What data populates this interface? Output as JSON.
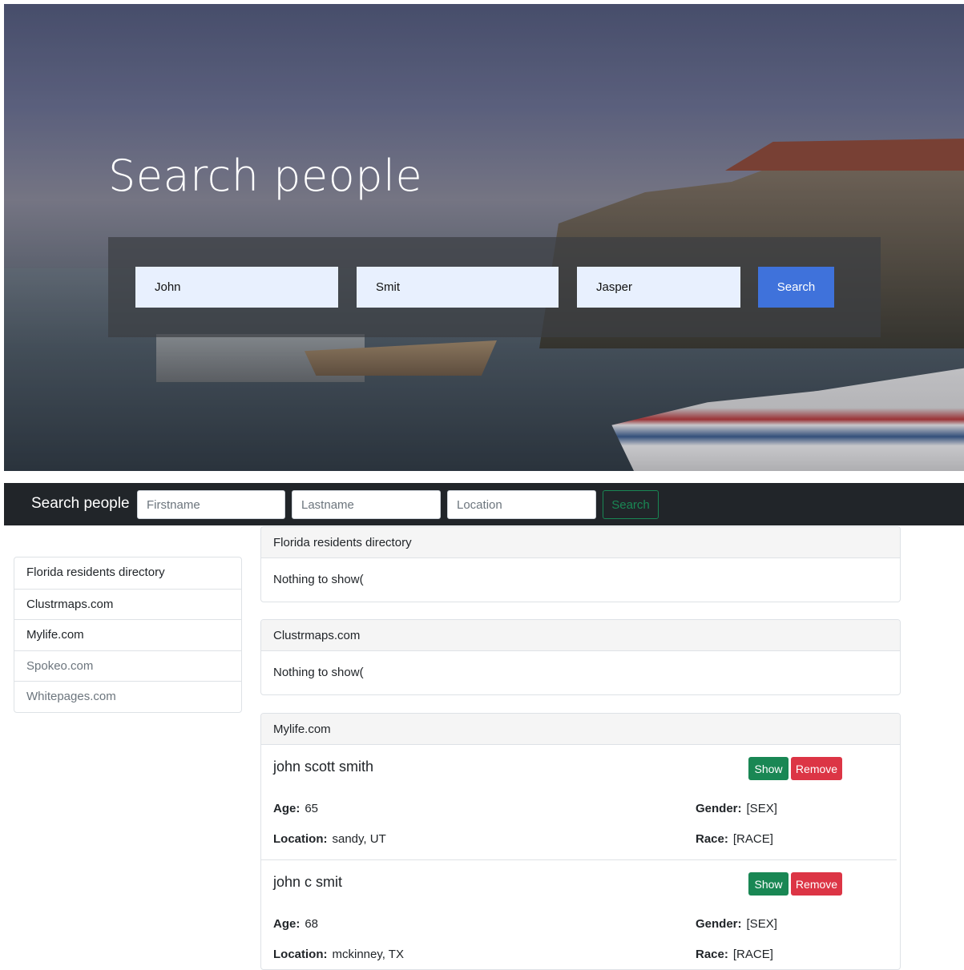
{
  "hero": {
    "title": "Search people",
    "firstname_value": "John",
    "lastname_value": "Smit",
    "location_value": "Jasper",
    "search_label": "Search"
  },
  "navbar": {
    "brand": "Search people",
    "firstname_placeholder": "Firstname",
    "lastname_placeholder": "Lastname",
    "location_placeholder": "Location",
    "search_label": "Search"
  },
  "sidebar": {
    "items": [
      {
        "label": "Florida residents directory"
      },
      {
        "label": "Clustrmaps.com"
      },
      {
        "label": "Mylife.com"
      },
      {
        "label": "Spokeo.com"
      },
      {
        "label": "Whitepages.com"
      }
    ]
  },
  "cards": [
    {
      "title": "Florida residents directory",
      "empty_text": "Nothing to show("
    },
    {
      "title": "Clustrmaps.com",
      "empty_text": "Nothing to show("
    },
    {
      "title": "Mylife.com",
      "people": [
        {
          "name": "john scott smith",
          "age_label": "Age:",
          "age": "65",
          "location_label": "Location:",
          "location": "sandy, UT",
          "gender_label": "Gender:",
          "gender": "[SEX]",
          "race_label": "Race:",
          "race": "[RACE]",
          "show_label": "Show",
          "remove_label": "Remove"
        },
        {
          "name": "john c smit",
          "age_label": "Age:",
          "age": "68",
          "location_label": "Location:",
          "location": "mckinney, TX",
          "gender_label": "Gender:",
          "gender": "[SEX]",
          "race_label": "Race:",
          "race": "[RACE]",
          "show_label": "Show",
          "remove_label": "Remove"
        }
      ]
    }
  ],
  "colors": {
    "primary": "#3f72db",
    "success": "#198754",
    "danger": "#dc3545",
    "navbar": "#212529"
  }
}
